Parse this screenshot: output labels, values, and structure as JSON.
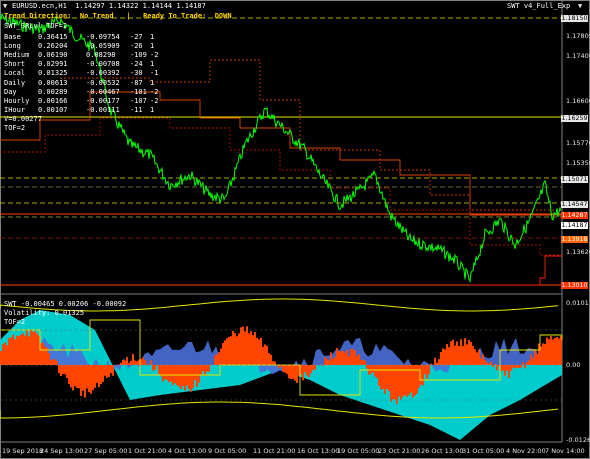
{
  "header": {
    "symbol_line": "EURUSD.ecn,H1  1.14297 1.14322 1.14144 1.14187",
    "trend_line": "Trend Direction:  No Trend   |   Ready To Trade:  DOWN",
    "indicator_name": "SWT v4_Full_Exp",
    "indicator_badge": "SWT_SRLvl_TOF=2"
  },
  "table": {
    "rows": [
      {
        "label": "Base",
        "a": "0.36415",
        "b": "-0.09754",
        "c": "-27",
        "d": "1"
      },
      {
        "label": "Long",
        "a": "0.26204",
        "b": "-0.05909",
        "c": "-26",
        "d": "1"
      },
      {
        "label": "Medium",
        "a": "0.06190",
        "b": "0.08298",
        "c": "-109",
        "d": "-2"
      },
      {
        "label": "Short",
        "a": "0.02991",
        "b": "-0.00708",
        "c": "-24",
        "d": "1"
      },
      {
        "label": "Local",
        "a": "0.01325",
        "b": "-0.00392",
        "c": "-30",
        "d": "-1"
      },
      {
        "label": "Daily",
        "a": "0.00613",
        "b": "-0.00532",
        "c": "-87",
        "d": "1"
      },
      {
        "label": "Day",
        "a": "0.00289",
        "b": "-0.00467",
        "c": "-101",
        "d": "-2"
      },
      {
        "label": "Hourly",
        "a": "0.00166",
        "b": "-0.00177",
        "c": "-107",
        "d": "-2"
      },
      {
        "label": "IHour",
        "a": "0.00107",
        "b": "-0.00111",
        "c": "-11",
        "d": "1"
      }
    ],
    "v_line": "V=0.00277",
    "tof_line": "TOF=2"
  },
  "price_axis": {
    "labels": [
      "1.18150",
      "1.17805",
      "1.17400",
      "1.16600",
      "1.16259",
      "1.15776",
      "1.15350",
      "1.15071",
      "1.14547",
      "1.14287",
      "1.14187",
      "1.13918",
      "1.13620",
      "1.13010"
    ]
  },
  "sub_window": {
    "title_line": "SWT -0.00465 0.00206 -0.00092",
    "volatility_line": "Volatility: 0.01325",
    "tof_line": "TOF=2",
    "axis_labels": [
      "0.0101",
      "0.00",
      "-0.01265"
    ]
  },
  "time_axis": {
    "labels": [
      "19 Sep 2018",
      "24 Sep 13:00",
      "27 Sep 05:00",
      "1 Oct 21:00",
      "4 Oct 13:00",
      "9 Oct 05:00",
      "11 Oct 21:00",
      "16 Oct 13:00",
      "19 Oct 05:00",
      "23 Oct 21:00",
      "26 Oct 13:00",
      "31 Oct 05:00",
      "4 Nov 22:00",
      "7 Nov 14:00"
    ]
  },
  "colors": {
    "price_line": "#00ff00",
    "trend_text": "#ffd400",
    "header_text": "#ffffff",
    "table_text": "#ffffff",
    "orange": "#ff4500",
    "cyan": "#00cccc",
    "blue": "#4a6fd8",
    "yellow": "#e6e600",
    "tag_gray": "#c8c8c8",
    "tag_red": "#ff3300",
    "tag_olive": "#999933"
  }
}
